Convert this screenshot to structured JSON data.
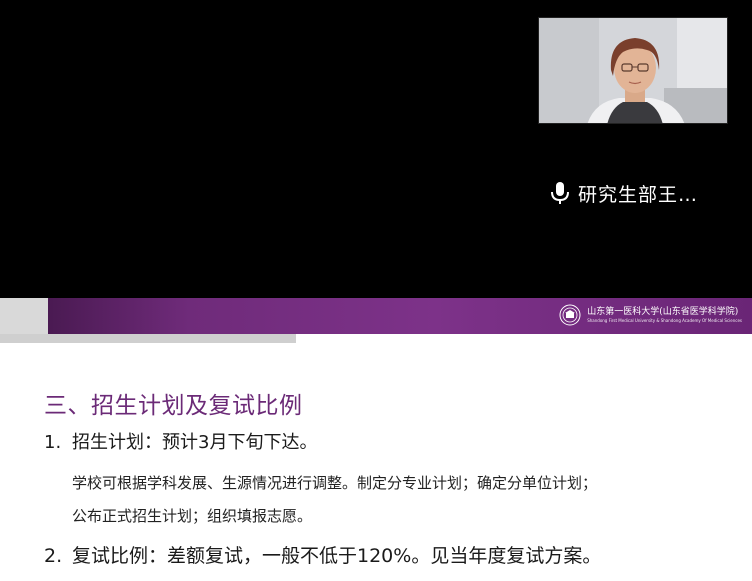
{
  "video": {
    "speaker_name": "研究生部王…",
    "mic_icon": "microphone-icon"
  },
  "slide": {
    "logo": {
      "chinese": "山东第一医科大学(山东省医学科学院)",
      "english": "Shandong First Medical University & Shandong Academy Of Medical Sciences"
    },
    "section_title": "三、招生计划及复试比例",
    "item1": {
      "number": "1.",
      "text": "招生计划：预计3月下旬下达。"
    },
    "detail_line1": "学校可根据学科发展、生源情况进行调整。制定分专业计划；确定分单位计划；",
    "detail_line2": "公布正式招生计划；组织填报志愿。",
    "item2": {
      "number": "2.",
      "text": "复试比例：差额复试，一般不低于120%。见当年度复试方案。"
    }
  },
  "colors": {
    "title_purple": "#6b2a77",
    "banner_purple": "#7d3289",
    "video_background": "#000000"
  }
}
